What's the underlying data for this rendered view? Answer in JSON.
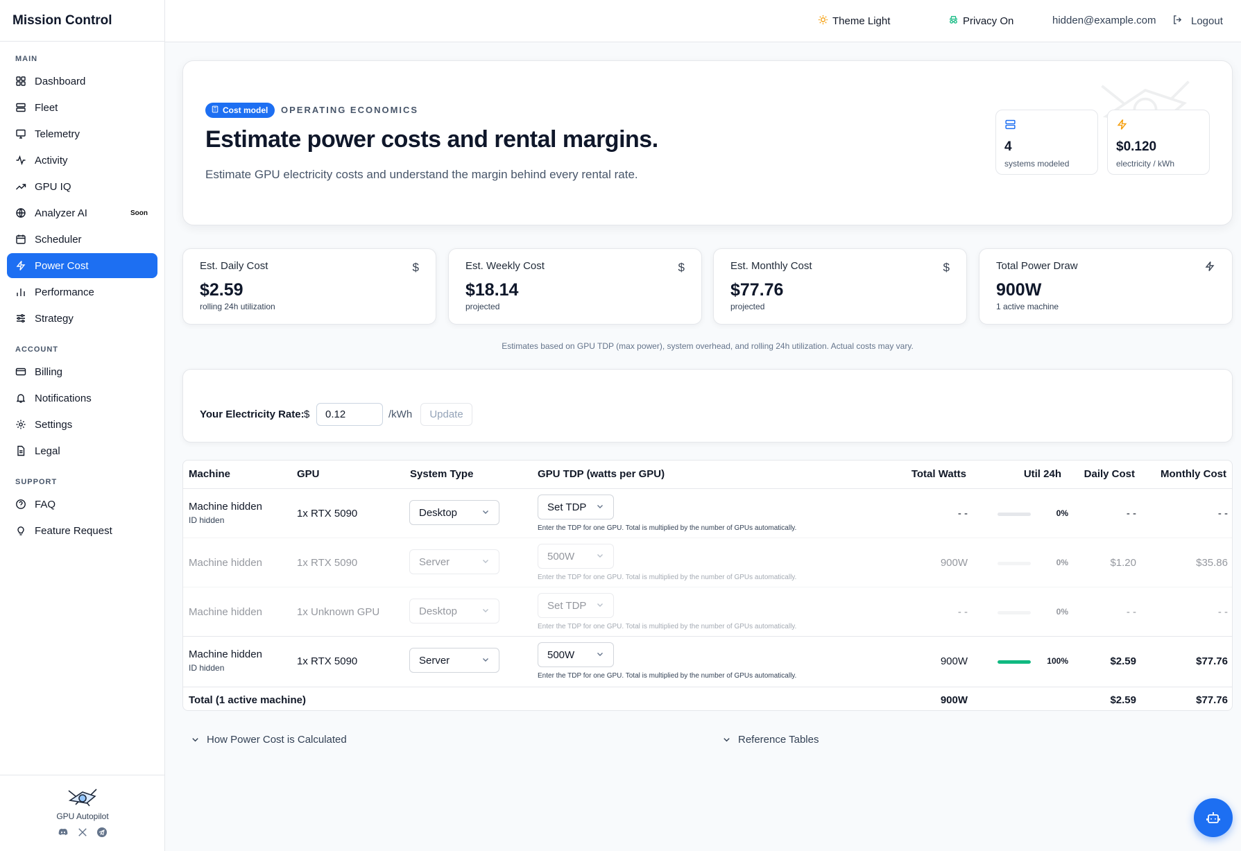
{
  "app": {
    "title": "Mission Control"
  },
  "sidebar": {
    "sections": [
      {
        "label": "MAIN",
        "items": [
          "Dashboard",
          "Fleet",
          "Telemetry",
          "Activity",
          "GPU IQ",
          "Analyzer AI",
          "Scheduler",
          "Power Cost",
          "Performance",
          "Strategy"
        ]
      },
      {
        "label": "ACCOUNT",
        "items": [
          "Billing",
          "Notifications",
          "Settings",
          "Legal"
        ]
      },
      {
        "label": "SUPPORT",
        "items": [
          "FAQ",
          "Feature Request"
        ]
      }
    ],
    "main_label": "MAIN",
    "account_label": "ACCOUNT",
    "support_label": "SUPPORT",
    "items": {
      "dashboard": "Dashboard",
      "fleet": "Fleet",
      "telemetry": "Telemetry",
      "activity": "Activity",
      "gpuiq": "GPU IQ",
      "analyzer": "Analyzer AI",
      "analyzer_badge": "Soon",
      "scheduler": "Scheduler",
      "powercost": "Power Cost",
      "performance": "Performance",
      "strategy": "Strategy",
      "billing": "Billing",
      "notifications": "Notifications",
      "settings": "Settings",
      "legal": "Legal",
      "faq": "FAQ",
      "feature": "Feature Request"
    },
    "active": "Power Cost",
    "footer_name": "GPU Autopilot",
    "accent": "#1d6ff2"
  },
  "topbar": {
    "theme": "Theme Light",
    "privacy": "Privacy On",
    "email": "hidden@example.com",
    "logout": "Logout"
  },
  "hero": {
    "badge": "Cost model",
    "eyebrow": "OPERATING ECONOMICS",
    "title": "Estimate power costs and rental margins.",
    "subtitle": "Estimate GPU electricity costs and understand the margin behind every rental rate.",
    "stats": [
      {
        "value": "4",
        "label": "systems modeled"
      },
      {
        "value": "$0.120",
        "label": "electricity / kWh"
      }
    ]
  },
  "kpis": [
    {
      "title": "Est. Daily Cost",
      "value": "$2.59",
      "sub": "rolling 24h utilization",
      "icon": "$"
    },
    {
      "title": "Est. Weekly Cost",
      "value": "$18.14",
      "sub": "projected",
      "icon": "$"
    },
    {
      "title": "Est. Monthly Cost",
      "value": "$77.76",
      "sub": "projected",
      "icon": "$"
    },
    {
      "title": "Total Power Draw",
      "value": "900W",
      "sub": "1 active machine",
      "icon": "bolt-icon"
    }
  ],
  "note": "Estimates based on GPU TDP (max power), system overhead, and rolling 24h utilization. Actual costs may vary.",
  "rate": {
    "label": "Your Electricity Rate:",
    "currency": "$",
    "value": "0.12",
    "unit": "/kWh",
    "button": "Update"
  },
  "table": {
    "headers": {
      "machine": "Machine",
      "gpu": "GPU",
      "system": "System Type",
      "tdp": "GPU TDP (watts per GPU)",
      "watts": "Total Watts",
      "util": "Util 24h",
      "daily": "Daily Cost",
      "monthly": "Monthly Cost"
    },
    "hint": "Enter the TDP for one GPU. Total is multiplied by the number of GPUs automatically.",
    "rows": [
      {
        "machine": "Machine hidden",
        "id": "ID hidden",
        "gpu": "1x RTX 5090",
        "system": "Desktop",
        "tdp": "Set TDP",
        "watts": "- -",
        "util": 0,
        "util_label": "0%",
        "daily": "- -",
        "monthly": "- -"
      },
      {
        "machine": "Machine hidden",
        "id": "",
        "gpu": "1x RTX 5090",
        "system": "Server",
        "tdp": "500W",
        "watts": "900W",
        "util": 0,
        "util_label": "0%",
        "daily": "$1.20",
        "monthly": "$35.86"
      },
      {
        "machine": "Machine hidden",
        "id": "",
        "gpu": "1x Unknown GPU",
        "system": "Desktop",
        "tdp": "Set TDP",
        "watts": "- -",
        "util": 0,
        "util_label": "0%",
        "daily": "- -",
        "monthly": "- -"
      },
      {
        "machine": "Machine hidden",
        "id": "ID hidden",
        "gpu": "1x RTX 5090",
        "system": "Server",
        "tdp": "500W",
        "watts": "900W",
        "util": 1.0,
        "util_label": "100%",
        "daily": "$2.59",
        "monthly": "$77.76"
      }
    ],
    "total": {
      "label": "Total (1 active machine)",
      "watts": "900W",
      "daily": "$2.59",
      "monthly": "$77.76"
    }
  },
  "collapsibles": {
    "how": "How Power Cost is Calculated",
    "reference": "Reference Tables"
  }
}
